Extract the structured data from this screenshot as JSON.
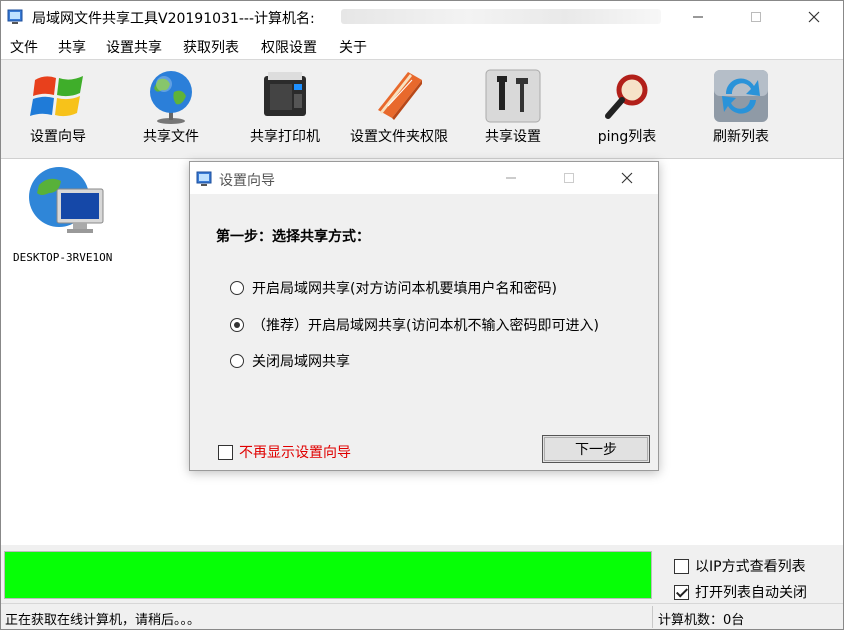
{
  "window": {
    "title": "局域网文件共享工具V20191031---计算机名:"
  },
  "menu": [
    "文件",
    "共享",
    "设置共享",
    "获取列表",
    "权限设置",
    "关于"
  ],
  "toolbar": [
    {
      "label": "设置向导",
      "icon": "windows-logo-icon"
    },
    {
      "label": "共享文件",
      "icon": "globe-icon"
    },
    {
      "label": "共享打印机",
      "icon": "printer-icon"
    },
    {
      "label": "设置文件夹权限",
      "icon": "folder-book-icon"
    },
    {
      "label": "共享设置",
      "icon": "tools-icon"
    },
    {
      "label": "ping列表",
      "icon": "magnifier-icon"
    },
    {
      "label": "刷新列表",
      "icon": "refresh-icon"
    }
  ],
  "computers": [
    {
      "name": "DESKTOP-3RVE1ON",
      "icon": "network-computer-icon"
    }
  ],
  "dialog": {
    "title": "设置向导",
    "step_title": "第一步：选择共享方式：",
    "options": [
      {
        "label": "开启局域网共享(对方访问本机要填用户名和密码)",
        "selected": false
      },
      {
        "label": "（推荐）开启局域网共享(访问本机不输入密码即可进入)",
        "selected": true
      },
      {
        "label": "关闭局域网共享",
        "selected": false
      }
    ],
    "dont_show_label": "不再显示设置向导",
    "dont_show_checked": false,
    "next_label": "下一步"
  },
  "bottom": {
    "progress": 1.0,
    "progress_color": "#06ff06",
    "view_by_ip_label": "以IP方式查看列表",
    "view_by_ip_checked": false,
    "auto_close_label": "打开列表自动关闭",
    "auto_close_checked": true
  },
  "status": {
    "left": "正在获取在线计算机，请稍后。。。",
    "right": "计算机数：0台"
  }
}
